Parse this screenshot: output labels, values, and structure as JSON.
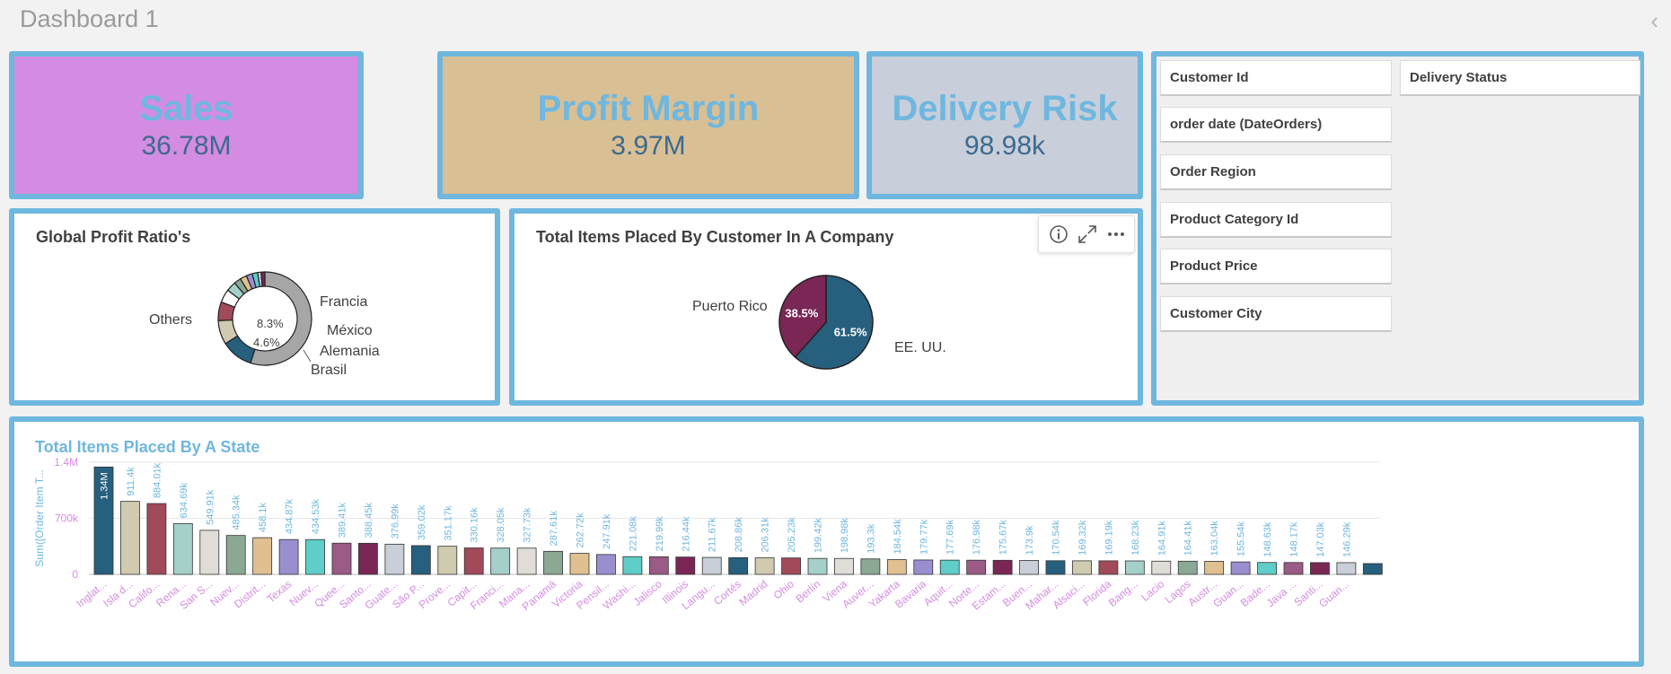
{
  "header": {
    "title": "Dashboard 1",
    "collapse_icon": "chevron-left-icon"
  },
  "kpis": [
    {
      "label": "Sales",
      "value": "36.78M",
      "bg": "#d48ce2"
    },
    {
      "label": "Profit Margin",
      "value": "3.97M",
      "bg": "#d9bf94"
    },
    {
      "label": "Delivery Risk",
      "value": "98.98k",
      "bg": "#c8cfda"
    }
  ],
  "donut": {
    "title": "Global Profit Ratio's",
    "center_line1": "8.3%",
    "center_line2": "4.6%",
    "labels": {
      "others": "Others",
      "francia": "Francia",
      "mexico": "México",
      "alemania": "Alemania",
      "brasil": "Brasil"
    }
  },
  "pie": {
    "title": "Total Items Placed By Customer In A Company",
    "slices": [
      {
        "label": "EE. UU.",
        "pct_label": "61.5%",
        "value": 61.5,
        "color": "#27607e"
      },
      {
        "label": "Puerto Rico",
        "pct_label": "38.5%",
        "value": 38.5,
        "color": "#7a2755"
      }
    ],
    "toolbar": {
      "info": "info-icon",
      "expand": "expand-icon",
      "more": "more-icon"
    }
  },
  "filters": {
    "left": [
      "Customer Id",
      "order date (DateOrders)",
      "Order Region",
      "Product Category Id",
      "Product Price",
      "Customer City"
    ],
    "right": [
      "Delivery Status"
    ]
  },
  "chart_data": [
    {
      "type": "pie",
      "title": "Global Profit Ratio's",
      "donut": true,
      "labels": [
        "Others",
        "Francia",
        "México",
        "Alemania",
        "Brasil"
      ],
      "center_labels": [
        "8.3%",
        "4.6%"
      ],
      "slices": [
        {
          "label": "Others",
          "value": 55.0,
          "color": "#a6a6a6"
        },
        {
          "label": "",
          "value": 11.0,
          "color": "#27607e"
        },
        {
          "label": "Francia",
          "value": 8.3,
          "color": "#cfcab0"
        },
        {
          "label": "México",
          "value": 6.5,
          "color": "#a04a5a"
        },
        {
          "label": "",
          "value": 4.6,
          "color": "#ffffff"
        },
        {
          "label": "Alemania",
          "value": 3.4,
          "color": "#a5cfc9"
        },
        {
          "label": "",
          "value": 2.4,
          "color": "#8aa894"
        },
        {
          "label": "Brasil",
          "value": 2.3,
          "color": "#e0c090"
        },
        {
          "label": "",
          "value": 2.1,
          "color": "#9b8ed0"
        },
        {
          "label": "",
          "value": 1.9,
          "color": "#5fcdc8"
        },
        {
          "label": "",
          "value": 1.2,
          "color": "#c9ced8"
        },
        {
          "label": "",
          "value": 1.3,
          "color": "#7a2755"
        }
      ]
    },
    {
      "type": "pie",
      "title": "Total Items Placed By Customer In A Company",
      "labels": [
        "EE. UU.",
        "Puerto Rico"
      ],
      "values": [
        61.5,
        38.5
      ]
    },
    {
      "type": "bar",
      "title": "Total Items Placed By A State",
      "ylabel": "Sum([Order Item T...",
      "yticks": [
        "0",
        "700k",
        "1.4M"
      ],
      "ylim": [
        0,
        1400000
      ],
      "categories": [
        "Inglat...",
        "Isla d...",
        "Califo...",
        "Rena...",
        "San S...",
        "Nuev...",
        "Distrit...",
        "Texas",
        "Nuev...",
        "Quee...",
        "Santo...",
        "Guate...",
        "São P...",
        "Prove...",
        "Capit...",
        "Franci...",
        "Mana...",
        "Panamá",
        "Victoria",
        "Pensil...",
        "Washi...",
        "Jalisco",
        "Illinois",
        "Langu...",
        "Cortés",
        "Madrid",
        "Ohio",
        "Berlín",
        "Viena",
        "Auver...",
        "Yakarta",
        "Bavaria",
        "Aquit...",
        "Norte...",
        "Estam...",
        "Buen...",
        "Mahar...",
        "Alsaci...",
        "Florida",
        "Bang...",
        "Lacio",
        "Lagos",
        "Austr...",
        "Guan...",
        "Bade...",
        "Java ...",
        "Santi...",
        "Guan..."
      ],
      "values": [
        1340000,
        911400,
        884010,
        634690,
        549910,
        485340,
        458100,
        434870,
        434530,
        389410,
        388450,
        376990,
        359020,
        351170,
        330160,
        328050,
        327730,
        287610,
        262720,
        247910,
        221080,
        219990,
        216440,
        211670,
        208860,
        206310,
        205230,
        199420,
        198980,
        193300,
        184540,
        179770,
        177690,
        176980,
        175670,
        173900,
        170540,
        169320,
        169190,
        168230,
        164910,
        164410,
        163040,
        155540,
        148630,
        148170,
        147030,
        146290,
        135000
      ],
      "value_labels": [
        "1.34M",
        "911.4k",
        "884.01k",
        "634.69k",
        "549.91k",
        "485.34k",
        "458.1k",
        "434.87k",
        "434.53k",
        "389.41k",
        "388.45k",
        "376.99k",
        "359.02k",
        "351.17k",
        "330.16k",
        "328.05k",
        "327.73k",
        "287.61k",
        "262.72k",
        "247.91k",
        "221.08k",
        "219.99k",
        "216.44k",
        "211.67k",
        "208.86k",
        "206.31k",
        "205.23k",
        "199.42k",
        "198.98k",
        "193.3k",
        "184.54k",
        "179.77k",
        "177.69k",
        "176.98k",
        "175.67k",
        "173.9k",
        "170.54k",
        "169.32k",
        "169.19k",
        "168.23k",
        "164.91k",
        "164.41k",
        "163.04k",
        "155.54k",
        "148.63k",
        "148.17k",
        "147.03k",
        "146.29k",
        ""
      ],
      "colors": [
        "#27607e",
        "#cfcab0",
        "#a04a5a",
        "#a5cfc9",
        "#e0ddd8",
        "#8aa894",
        "#e0c090",
        "#9b8ed0",
        "#5fcdc8",
        "#9a5b86",
        "#7a2755",
        "#c9ced8"
      ],
      "grid": true
    }
  ]
}
